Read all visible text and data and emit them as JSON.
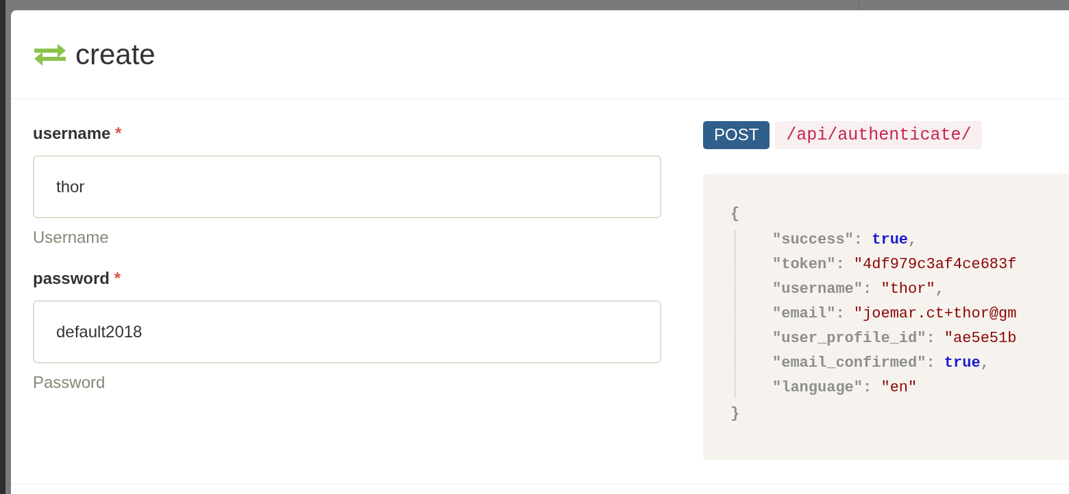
{
  "dialog": {
    "title": "create"
  },
  "fields": [
    {
      "label": "username",
      "required_mark": "*",
      "value": "thor",
      "help": "Username"
    },
    {
      "label": "password",
      "required_mark": "*",
      "value": "default2018",
      "help": "Password"
    }
  ],
  "request": {
    "method": "POST",
    "path": "/api/authenticate/"
  },
  "response": {
    "open": "{",
    "close": "}",
    "lines": [
      {
        "key": "\"success\":",
        "value": "true",
        "kind": "boolean",
        "trail": ","
      },
      {
        "key": "\"token\":",
        "value": "\"4df979c3af4ce683f",
        "kind": "string"
      },
      {
        "key": "\"username\":",
        "value": "\"thor\"",
        "kind": "string",
        "trail": ","
      },
      {
        "key": "\"email\":",
        "value": "\"joemar.ct+thor@gm",
        "kind": "string"
      },
      {
        "key": "\"user_profile_id\":",
        "value": "\"ae5e51b",
        "kind": "string"
      },
      {
        "key": "\"email_confirmed\":",
        "value": "true",
        "kind": "boolean",
        "trail": ","
      },
      {
        "key": "\"language\":",
        "value": "\"en\"",
        "kind": "string"
      }
    ]
  }
}
